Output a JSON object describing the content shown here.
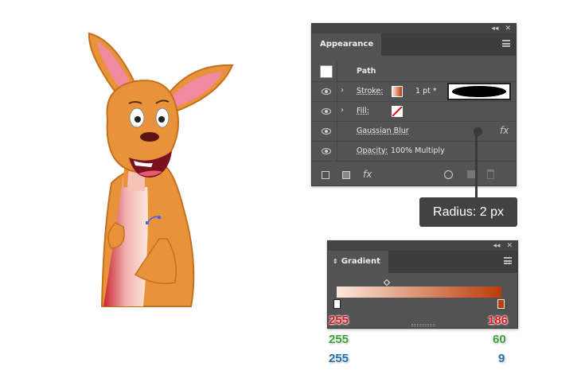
{
  "appearance": {
    "tab_label": "Appearance",
    "collapse_glyph": "◂◂",
    "close_glyph": "✕",
    "path_label": "Path",
    "stroke": {
      "label": "Stroke:",
      "weight": "1 pt *"
    },
    "fill": {
      "label": "Fill:"
    },
    "effect": {
      "label": "Gaussian Blur",
      "fx": "fx"
    },
    "opacity": {
      "label": "Opacity:",
      "value": "100% Multiply"
    },
    "bottom_fx": "fx"
  },
  "tooltip": {
    "text": "Radius: 2 px"
  },
  "gradient": {
    "tab_label": "Gradient",
    "collapse_glyph": "◂◂",
    "close_glyph": "✕",
    "start_color": "#fce8dc",
    "end_color": "#ba3c09"
  },
  "color_values": {
    "left": {
      "r": "255",
      "g": "255",
      "b": "255"
    },
    "right": {
      "r": "186",
      "g": "60",
      "b": "9"
    },
    "red_color": "#e0161e",
    "green_color": "#3aa13a",
    "blue_color": "#1f6fb0"
  }
}
